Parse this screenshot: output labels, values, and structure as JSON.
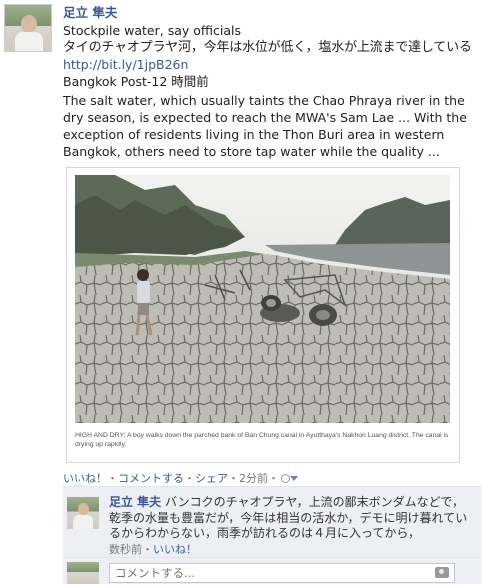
{
  "post": {
    "author": "足立 隼夫",
    "title": "Stockpile water, say officials",
    "headline_jp": "タイのチャオプラヤ河，今年は水位が低く，塩水が上流まで達している",
    "link": "http://bit.ly/1jpB26n",
    "source": "Bangkok Post-12 時間前",
    "description": "The salt water, which usually taints the Chao Phraya river in the dry season, is expected to reach the MWA's Sam Lae ... With the exception of residents living in the Thon Buri area in western Bangkok, others need to store tap water while the quality ..."
  },
  "photo": {
    "caption": "HIGH AND DRY: A boy walks down the parched bank of Ban Chung canal in Ayutthaya's Nakhon Luang district. The canal is drying up rapidly."
  },
  "actions": {
    "like": "いいね！",
    "sep1": "・",
    "comment": "コメントする",
    "sep2": "・",
    "share": "シェア",
    "sep3": "・",
    "time": "2分前",
    "sep4": "・"
  },
  "comment": {
    "author": "足立 隼夫",
    "text": "バンコクのチャオプラヤ，上流の鄙末ボンダムなどで，乾季の水量も豊富だが，今年は相当の活水か，デモに明け暮れているからわからない，雨季が訪れるのは４月に入ってから，",
    "time": "数秒前",
    "sep": "・",
    "like": "いいね！"
  },
  "compose": {
    "placeholder": "コメントする..."
  },
  "colors": {
    "link_blue": "#3b5998",
    "ufi_background": "#edeff4"
  }
}
